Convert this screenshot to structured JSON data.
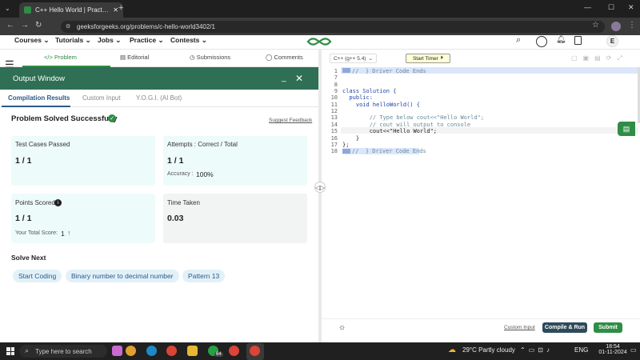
{
  "browser": {
    "tab_title": "C++ Hello World | Practice | Ge",
    "url": "geeksforgeeks.org/problems/c-hello-world3402/1"
  },
  "site_nav": {
    "items": [
      "Courses",
      "Tutorials",
      "Jobs",
      "Practice",
      "Contests"
    ],
    "avatar": "E"
  },
  "problem_tabs": [
    "Problem",
    "Editorial",
    "Submissions",
    "Comments"
  ],
  "output_window": {
    "title": "Output Window",
    "tabs": [
      "Compilation Results",
      "Custom Input",
      "Y.O.G.I. (AI Bot)"
    ],
    "status": "Problem Solved Successfully",
    "suggest_feedback": "Suggest Feedback",
    "cards": {
      "test_cases_label": "Test Cases Passed",
      "test_cases_value": "1 / 1",
      "attempts_label": "Attempts : Correct / Total",
      "attempts_value": "1 / 1",
      "accuracy_label": "Accuracy :",
      "accuracy_value": "100%",
      "points_label": "Points Scored",
      "points_value": "1 / 1",
      "total_score_label": "Your Total Score:",
      "total_score_value": "1",
      "time_label": "Time Taken",
      "time_value": "0.03"
    },
    "solve_next_title": "Solve Next",
    "solve_next": [
      "Start Coding",
      "Binary number to decimal number",
      "Pattern 13"
    ]
  },
  "editor": {
    "language": "C++ (g++ 5.4)",
    "start_timer": "Start Timer",
    "lines": [
      {
        "n": "1",
        "text": "//  } Driver Code Ends"
      },
      {
        "n": "7",
        "text": ""
      },
      {
        "n": "8",
        "text": ""
      },
      {
        "n": "9",
        "text": "class Solution {"
      },
      {
        "n": "10",
        "text": "  public:"
      },
      {
        "n": "11",
        "text": "    void helloWorld() {"
      },
      {
        "n": "12",
        "text": ""
      },
      {
        "n": "13",
        "text": "        // Type below cout<<\"Hello World\";"
      },
      {
        "n": "14",
        "text": "        // cout will output to console"
      },
      {
        "n": "15",
        "text": "        cout<<\"Hello World\";"
      },
      {
        "n": "16",
        "text": "    }"
      },
      {
        "n": "17",
        "text": "};"
      },
      {
        "n": "18",
        "text": "//  } Driver Code Ends"
      }
    ],
    "custom_input": "Custom Input",
    "compile_run": "Compile & Run",
    "submit": "Submit"
  },
  "taskbar": {
    "search_placeholder": "Type here to search",
    "weather": "29°C  Partly cloudy",
    "lang": "ENG",
    "time": "18:54",
    "date": "01-11-2024",
    "badge": "64"
  },
  "colors": {
    "gfg_green": "#2f8d46",
    "output_header": "#2f6f55",
    "card_teal": "#eefbfb",
    "chip_blue": "#e2f1f8"
  }
}
